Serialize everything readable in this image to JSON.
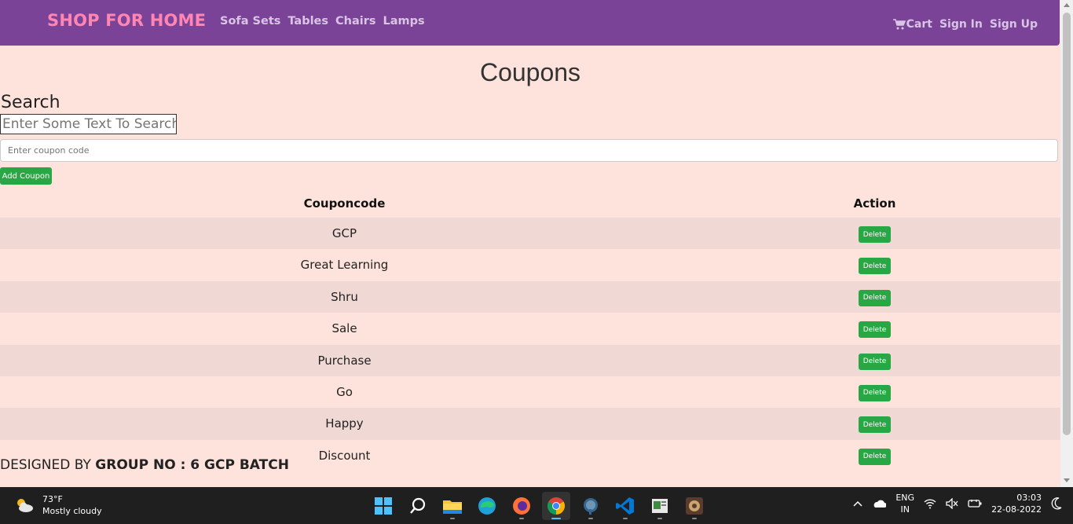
{
  "navbar": {
    "brand": "SHOP FOR HOME",
    "links": [
      "Sofa Sets",
      "Tables",
      "Chairs",
      "Lamps"
    ],
    "cart": "Cart",
    "sign_in": "Sign In",
    "sign_up": "Sign Up"
  },
  "page": {
    "title": "Coupons",
    "search_heading": "Search",
    "search_placeholder": "Enter Some Text To Search",
    "coupon_placeholder": "Enter coupon code",
    "add_button": "Add Coupon"
  },
  "table": {
    "headers": [
      "Couponcode",
      "Action"
    ],
    "delete_label": "Delete",
    "rows": [
      "GCP",
      "Great Learning",
      "Shru",
      "Sale",
      "Purchase",
      "Go",
      "Happy",
      "Discount"
    ]
  },
  "footer": {
    "prefix": "DESIGNED BY ",
    "bold": "GROUP NO : 6 GCP BATCH"
  },
  "taskbar": {
    "temperature": "73°F",
    "weather": "Mostly cloudy",
    "lang_top": "ENG",
    "lang_bottom": "IN",
    "time": "03:03",
    "date": "22-08-2022"
  },
  "colors": {
    "navbar": "#7b4397",
    "brand": "#ff85b3",
    "background": "#fde3dc",
    "button": "#28a745"
  }
}
